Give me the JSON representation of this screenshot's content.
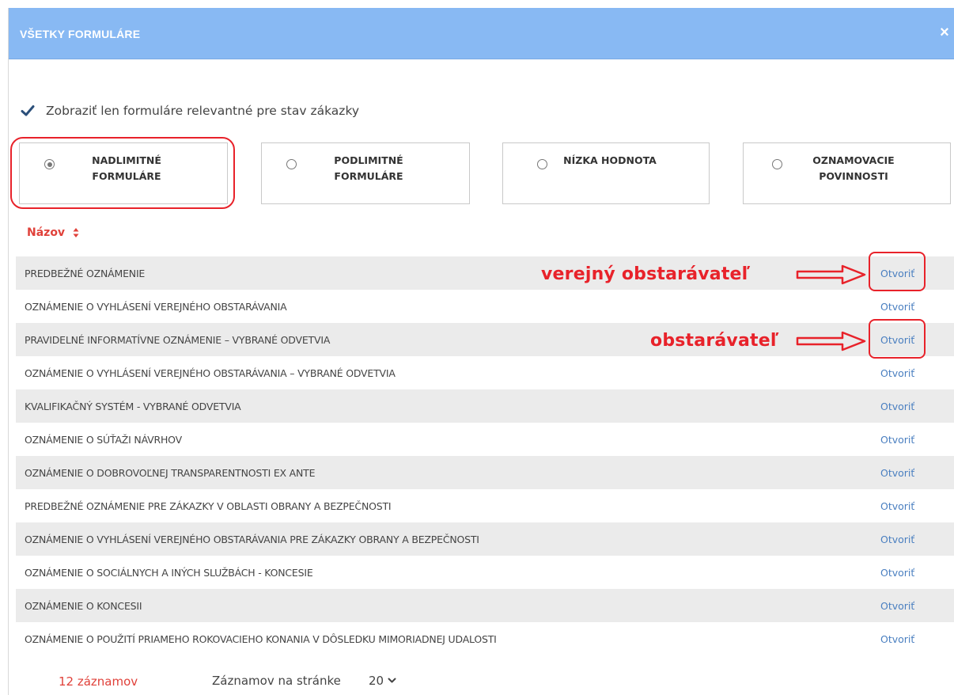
{
  "modal": {
    "title": "VŠETKY FORMULÁRE",
    "close_glyph": "×"
  },
  "filter": {
    "checked": true,
    "label": "Zobraziť len formuláre relevantné pre stav zákazky"
  },
  "types": [
    {
      "line1": "NADLIMITNÉ",
      "line2": "FORMULÁRE",
      "selected": true
    },
    {
      "line1": "PODLIMITNÉ",
      "line2": "FORMULÁRE",
      "selected": false
    },
    {
      "line1": "NÍZKA HODNOTA",
      "line2": "",
      "selected": false
    },
    {
      "line1": "OZNAMOVACIE",
      "line2": "POVINNOSTI",
      "selected": false
    }
  ],
  "table": {
    "sort_header": "Názov",
    "link_label": "Otvoriť",
    "rows": [
      "PREDBEŽNÉ OZNÁMENIE",
      "OZNÁMENIE O VYHLÁSENÍ VEREJNÉHO OBSTARÁVANIA",
      "PRAVIDELNÉ INFORMATÍVNE OZNÁMENIE – VYBRANÉ ODVETVIA",
      "OZNÁMENIE O VYHLÁSENÍ VEREJNÉHO OBSTARÁVANIA – VYBRANÉ ODVETVIA",
      "KVALIFIKAČNÝ SYSTÉM - VYBRANÉ ODVETVIA",
      "OZNÁMENIE O SÚŤAŽI NÁVRHOV",
      "OZNÁMENIE O DOBROVOĽNEJ TRANSPARENTNOSTI EX ANTE",
      "PREDBEŽNÉ OZNÁMENIE PRE ZÁKAZKY V OBLASTI OBRANY A BEZPEČNOSTI",
      "OZNÁMENIE O VYHLÁSENÍ VEREJNÉHO OBSTARÁVANIA PRE ZÁKAZKY OBRANY A BEZPEČNOSTI",
      "OZNÁMENIE O SOCIÁLNYCH A INÝCH SLUŽBÁCH - KONCESIE",
      "OZNÁMENIE O KONCESII",
      "OZNÁMENIE O POUŽITÍ PRIAMEHO ROKOVACIEHO KONANIA V DÔSLEDKU MIMORIADNEJ UDALOSTI"
    ]
  },
  "annotations": {
    "first": "verejný obstarávateľ",
    "second": "obstarávateľ"
  },
  "footer": {
    "count": "12 záznamov",
    "per_page_label": "Záznamov na stránke",
    "per_page_value": "20"
  },
  "colors": {
    "header": "#88b9f3",
    "accent_red": "#e8222a",
    "link": "#4a7fc0",
    "row_alt": "#ebebeb"
  }
}
